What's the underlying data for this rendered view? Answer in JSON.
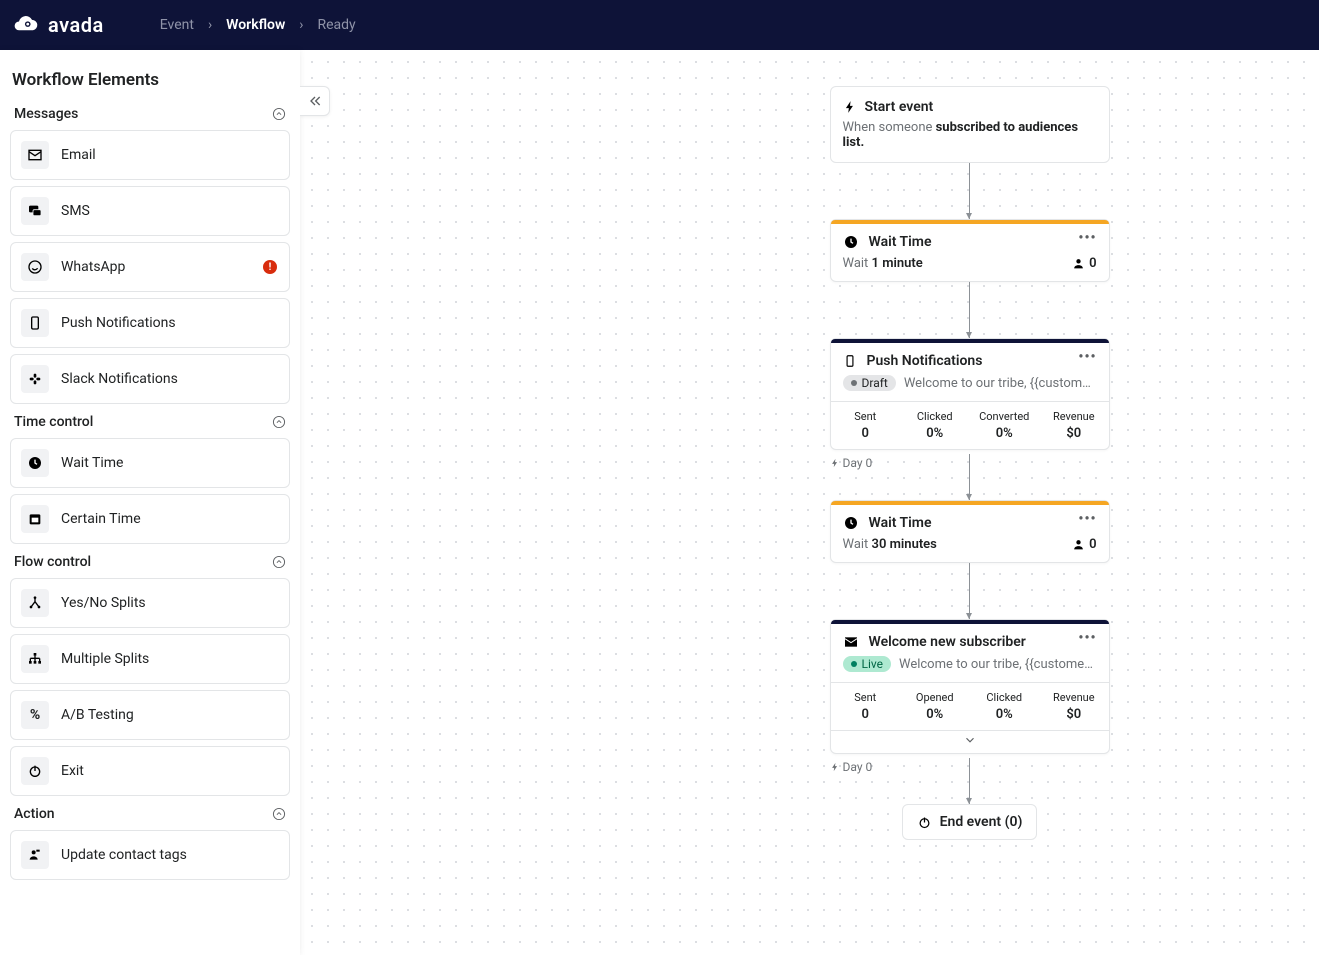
{
  "app_name": "avada",
  "breadcrumb": [
    "Event",
    "Workflow",
    "Ready"
  ],
  "breadcrumb_active_index": 1,
  "sidebar": {
    "title": "Workflow Elements",
    "sections": [
      {
        "name": "Messages",
        "items": [
          {
            "label": "Email",
            "icon": "email"
          },
          {
            "label": "SMS",
            "icon": "sms"
          },
          {
            "label": "WhatsApp",
            "icon": "whatsapp",
            "warn": true
          },
          {
            "label": "Push Notifications",
            "icon": "push"
          },
          {
            "label": "Slack Notifications",
            "icon": "slack"
          }
        ]
      },
      {
        "name": "Time control",
        "items": [
          {
            "label": "Wait Time",
            "icon": "clock"
          },
          {
            "label": "Certain Time",
            "icon": "calendar"
          }
        ]
      },
      {
        "name": "Flow control",
        "items": [
          {
            "label": "Yes/No Splits",
            "icon": "split"
          },
          {
            "label": "Multiple Splits",
            "icon": "multisplit"
          },
          {
            "label": "A/B Testing",
            "icon": "percent"
          },
          {
            "label": "Exit",
            "icon": "power"
          }
        ]
      },
      {
        "name": "Action",
        "items": [
          {
            "label": "Update contact tags",
            "icon": "tag"
          }
        ]
      }
    ]
  },
  "flow": {
    "start": {
      "title": "Start event",
      "desc_prefix": "When someone ",
      "desc_bold": "subscribed to audiences list."
    },
    "nodes": [
      {
        "type": "wait",
        "title": "Wait Time",
        "wait_prefix": "Wait ",
        "wait_value": "1 minute",
        "people": "0"
      },
      {
        "type": "push",
        "title": "Push Notifications",
        "status": "Draft",
        "subject": "Welcome to our tribe, {{customer...",
        "metrics": [
          {
            "label": "Sent",
            "value": "0"
          },
          {
            "label": "Clicked",
            "value": "0%"
          },
          {
            "label": "Converted",
            "value": "0%"
          },
          {
            "label": "Revenue",
            "value": "$0"
          }
        ],
        "day_tag": "Day 0"
      },
      {
        "type": "wait",
        "title": "Wait Time",
        "wait_prefix": "Wait ",
        "wait_value": "30 minutes",
        "people": "0"
      },
      {
        "type": "email",
        "title": "Welcome new subscriber",
        "status": "Live",
        "subject": "Welcome to our tribe, {{customer_...",
        "metrics": [
          {
            "label": "Sent",
            "value": "0"
          },
          {
            "label": "Opened",
            "value": "0%"
          },
          {
            "label": "Clicked",
            "value": "0%"
          },
          {
            "label": "Revenue",
            "value": "$0"
          }
        ],
        "day_tag": "Day 0",
        "expandable": true
      }
    ],
    "end": {
      "label": "End event (0)"
    }
  }
}
